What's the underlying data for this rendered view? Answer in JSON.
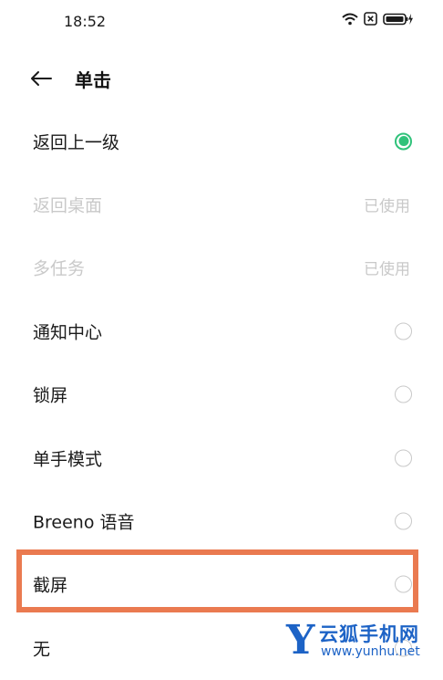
{
  "status_bar": {
    "time": "18:52",
    "icons": [
      "wifi-icon",
      "sim-blocked-icon",
      "battery-charging-icon"
    ]
  },
  "header": {
    "back_icon": "arrow-left-icon",
    "title": "单击"
  },
  "options": [
    {
      "label": "返回上一级",
      "state": "selected",
      "state_text": ""
    },
    {
      "label": "返回桌面",
      "state": "disabled",
      "state_text": "已使用"
    },
    {
      "label": "多任务",
      "state": "disabled",
      "state_text": "已使用"
    },
    {
      "label": "通知中心",
      "state": "unselected",
      "state_text": ""
    },
    {
      "label": "锁屏",
      "state": "unselected",
      "state_text": ""
    },
    {
      "label": "单手模式",
      "state": "unselected",
      "state_text": ""
    },
    {
      "label": "Breeno 语音",
      "state": "unselected",
      "state_text": ""
    },
    {
      "label": "截屏",
      "state": "unselected",
      "state_text": ""
    },
    {
      "label": "无",
      "state": "unselected",
      "state_text": ""
    }
  ],
  "highlight": {
    "target": "截屏",
    "color": "#ea7a50"
  },
  "watermark": {
    "logo": "Y",
    "name": "云狐手机网",
    "url": "www.yunhu.net",
    "color": "#1d63c6"
  },
  "colors": {
    "accent": "#2fc27a",
    "disabled_text": "#c9c9c9"
  }
}
